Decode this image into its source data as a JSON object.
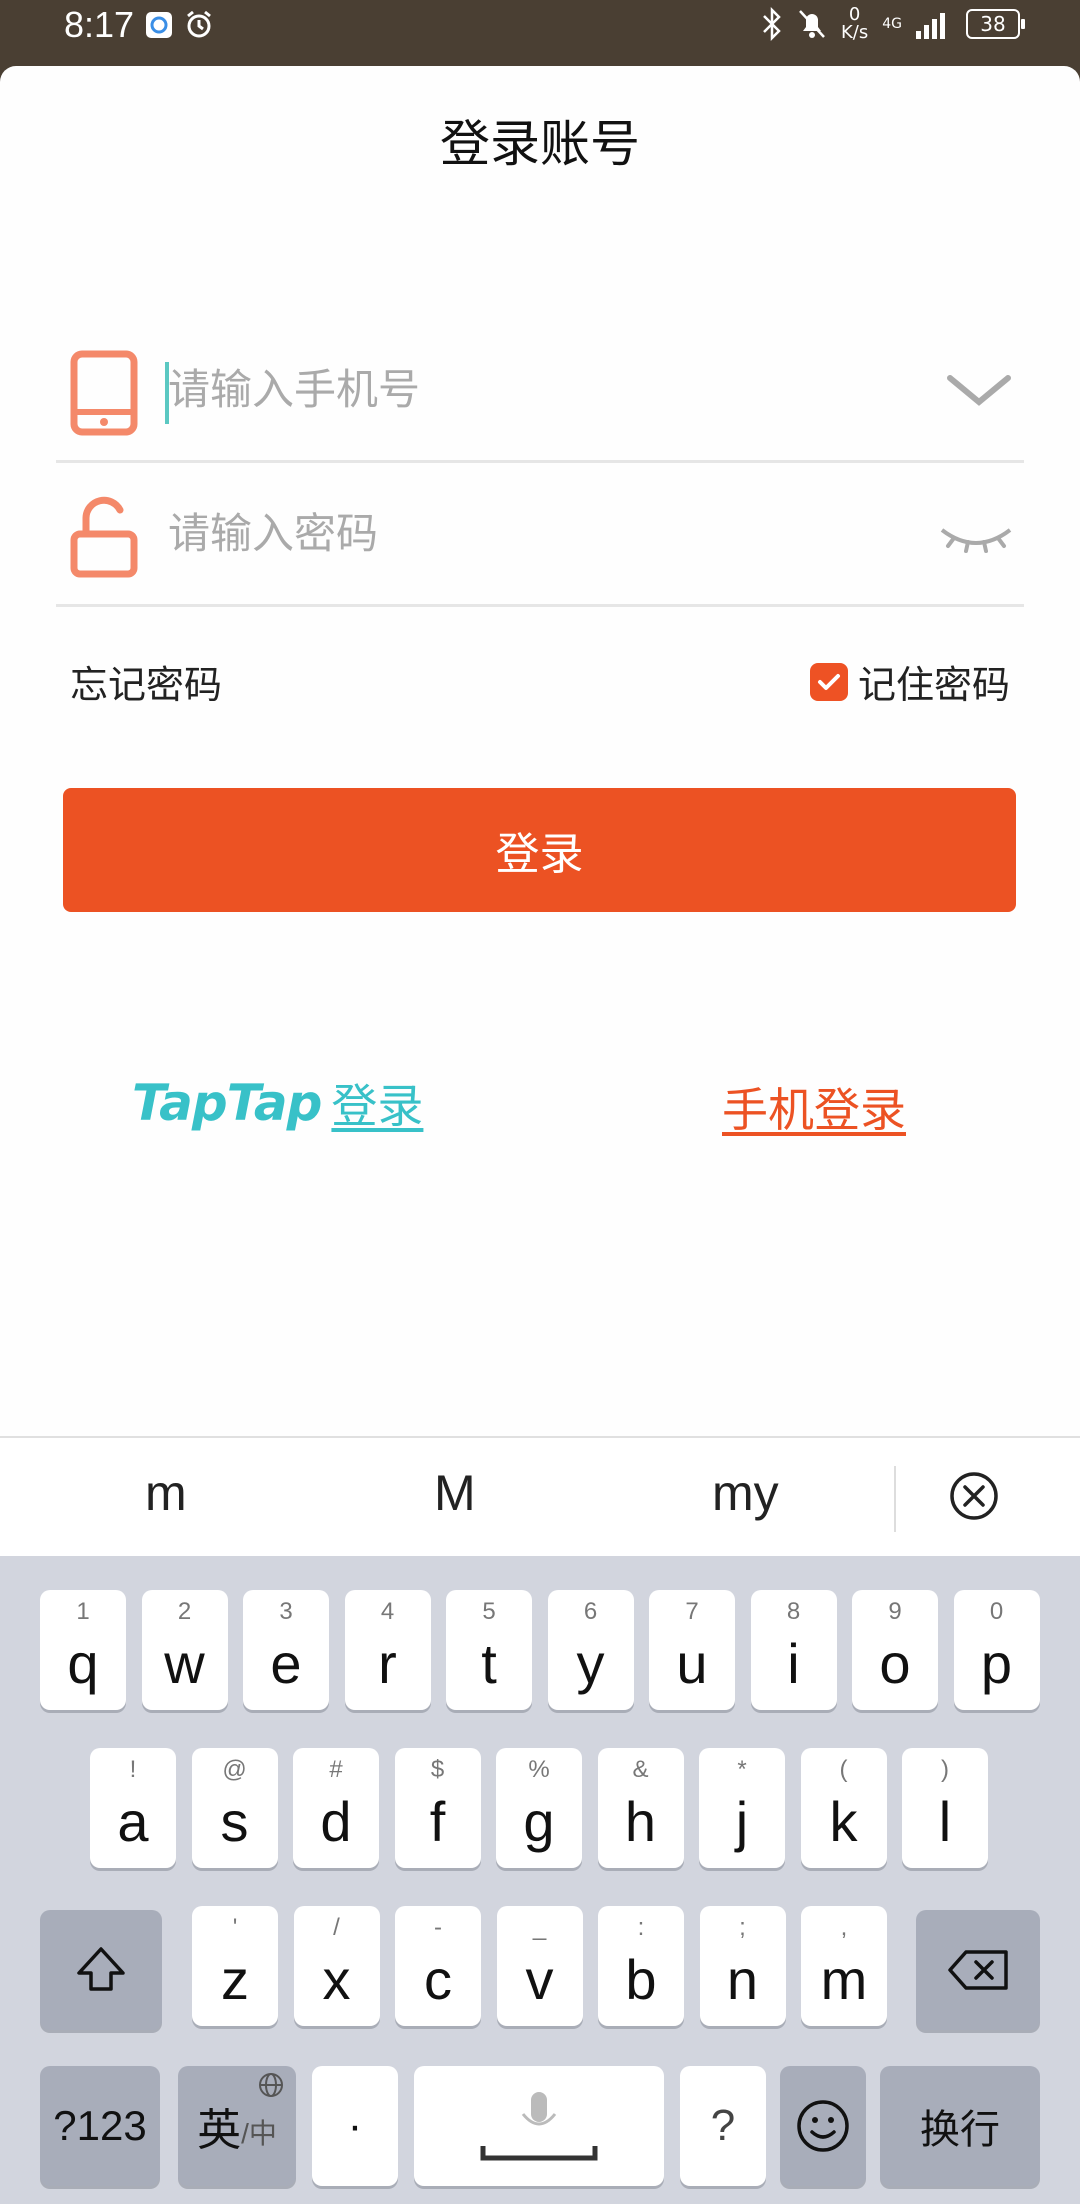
{
  "status_bar": {
    "time": "8:17",
    "net_speed_value": "0",
    "net_speed_unit": "K/s",
    "signal": "4G",
    "battery": "38"
  },
  "title": "登录账号",
  "phone_field": {
    "placeholder": "请输入手机号",
    "value": ""
  },
  "password_field": {
    "placeholder": "请输入密码",
    "value": ""
  },
  "options": {
    "forgot_password": "忘记密码",
    "remember_password": "记住密码",
    "remember_checked": true
  },
  "login_button": "登录",
  "alt_login": {
    "taptap_logo": "TapTap",
    "taptap_label": "登录",
    "phone_login": "手机登录"
  },
  "colors": {
    "accent": "#ec5223",
    "taptap": "#38c1c8",
    "icon_tint": "#f4896a"
  },
  "keyboard": {
    "suggestions": [
      "m",
      "M",
      "my"
    ],
    "row1": [
      {
        "k": "q",
        "s": "1"
      },
      {
        "k": "w",
        "s": "2"
      },
      {
        "k": "e",
        "s": "3"
      },
      {
        "k": "r",
        "s": "4"
      },
      {
        "k": "t",
        "s": "5"
      },
      {
        "k": "y",
        "s": "6"
      },
      {
        "k": "u",
        "s": "7"
      },
      {
        "k": "i",
        "s": "8"
      },
      {
        "k": "o",
        "s": "9"
      },
      {
        "k": "p",
        "s": "0"
      }
    ],
    "row2": [
      {
        "k": "a",
        "s": "!"
      },
      {
        "k": "s",
        "s": "@"
      },
      {
        "k": "d",
        "s": "#"
      },
      {
        "k": "f",
        "s": "$"
      },
      {
        "k": "g",
        "s": "%"
      },
      {
        "k": "h",
        "s": "&"
      },
      {
        "k": "j",
        "s": "*"
      },
      {
        "k": "k",
        "s": "("
      },
      {
        "k": "l",
        "s": ")"
      }
    ],
    "row3": [
      {
        "k": "z",
        "s": "'"
      },
      {
        "k": "x",
        "s": "/"
      },
      {
        "k": "c",
        "s": "-"
      },
      {
        "k": "v",
        "s": "_"
      },
      {
        "k": "b",
        "s": ":"
      },
      {
        "k": "n",
        "s": ";"
      },
      {
        "k": "m",
        "s": ","
      }
    ],
    "num_key": "?123",
    "lang_key_main": "英",
    "lang_key_sub": "/中",
    "dot_key": "·",
    "question_key": "?",
    "enter_key": "换行"
  }
}
